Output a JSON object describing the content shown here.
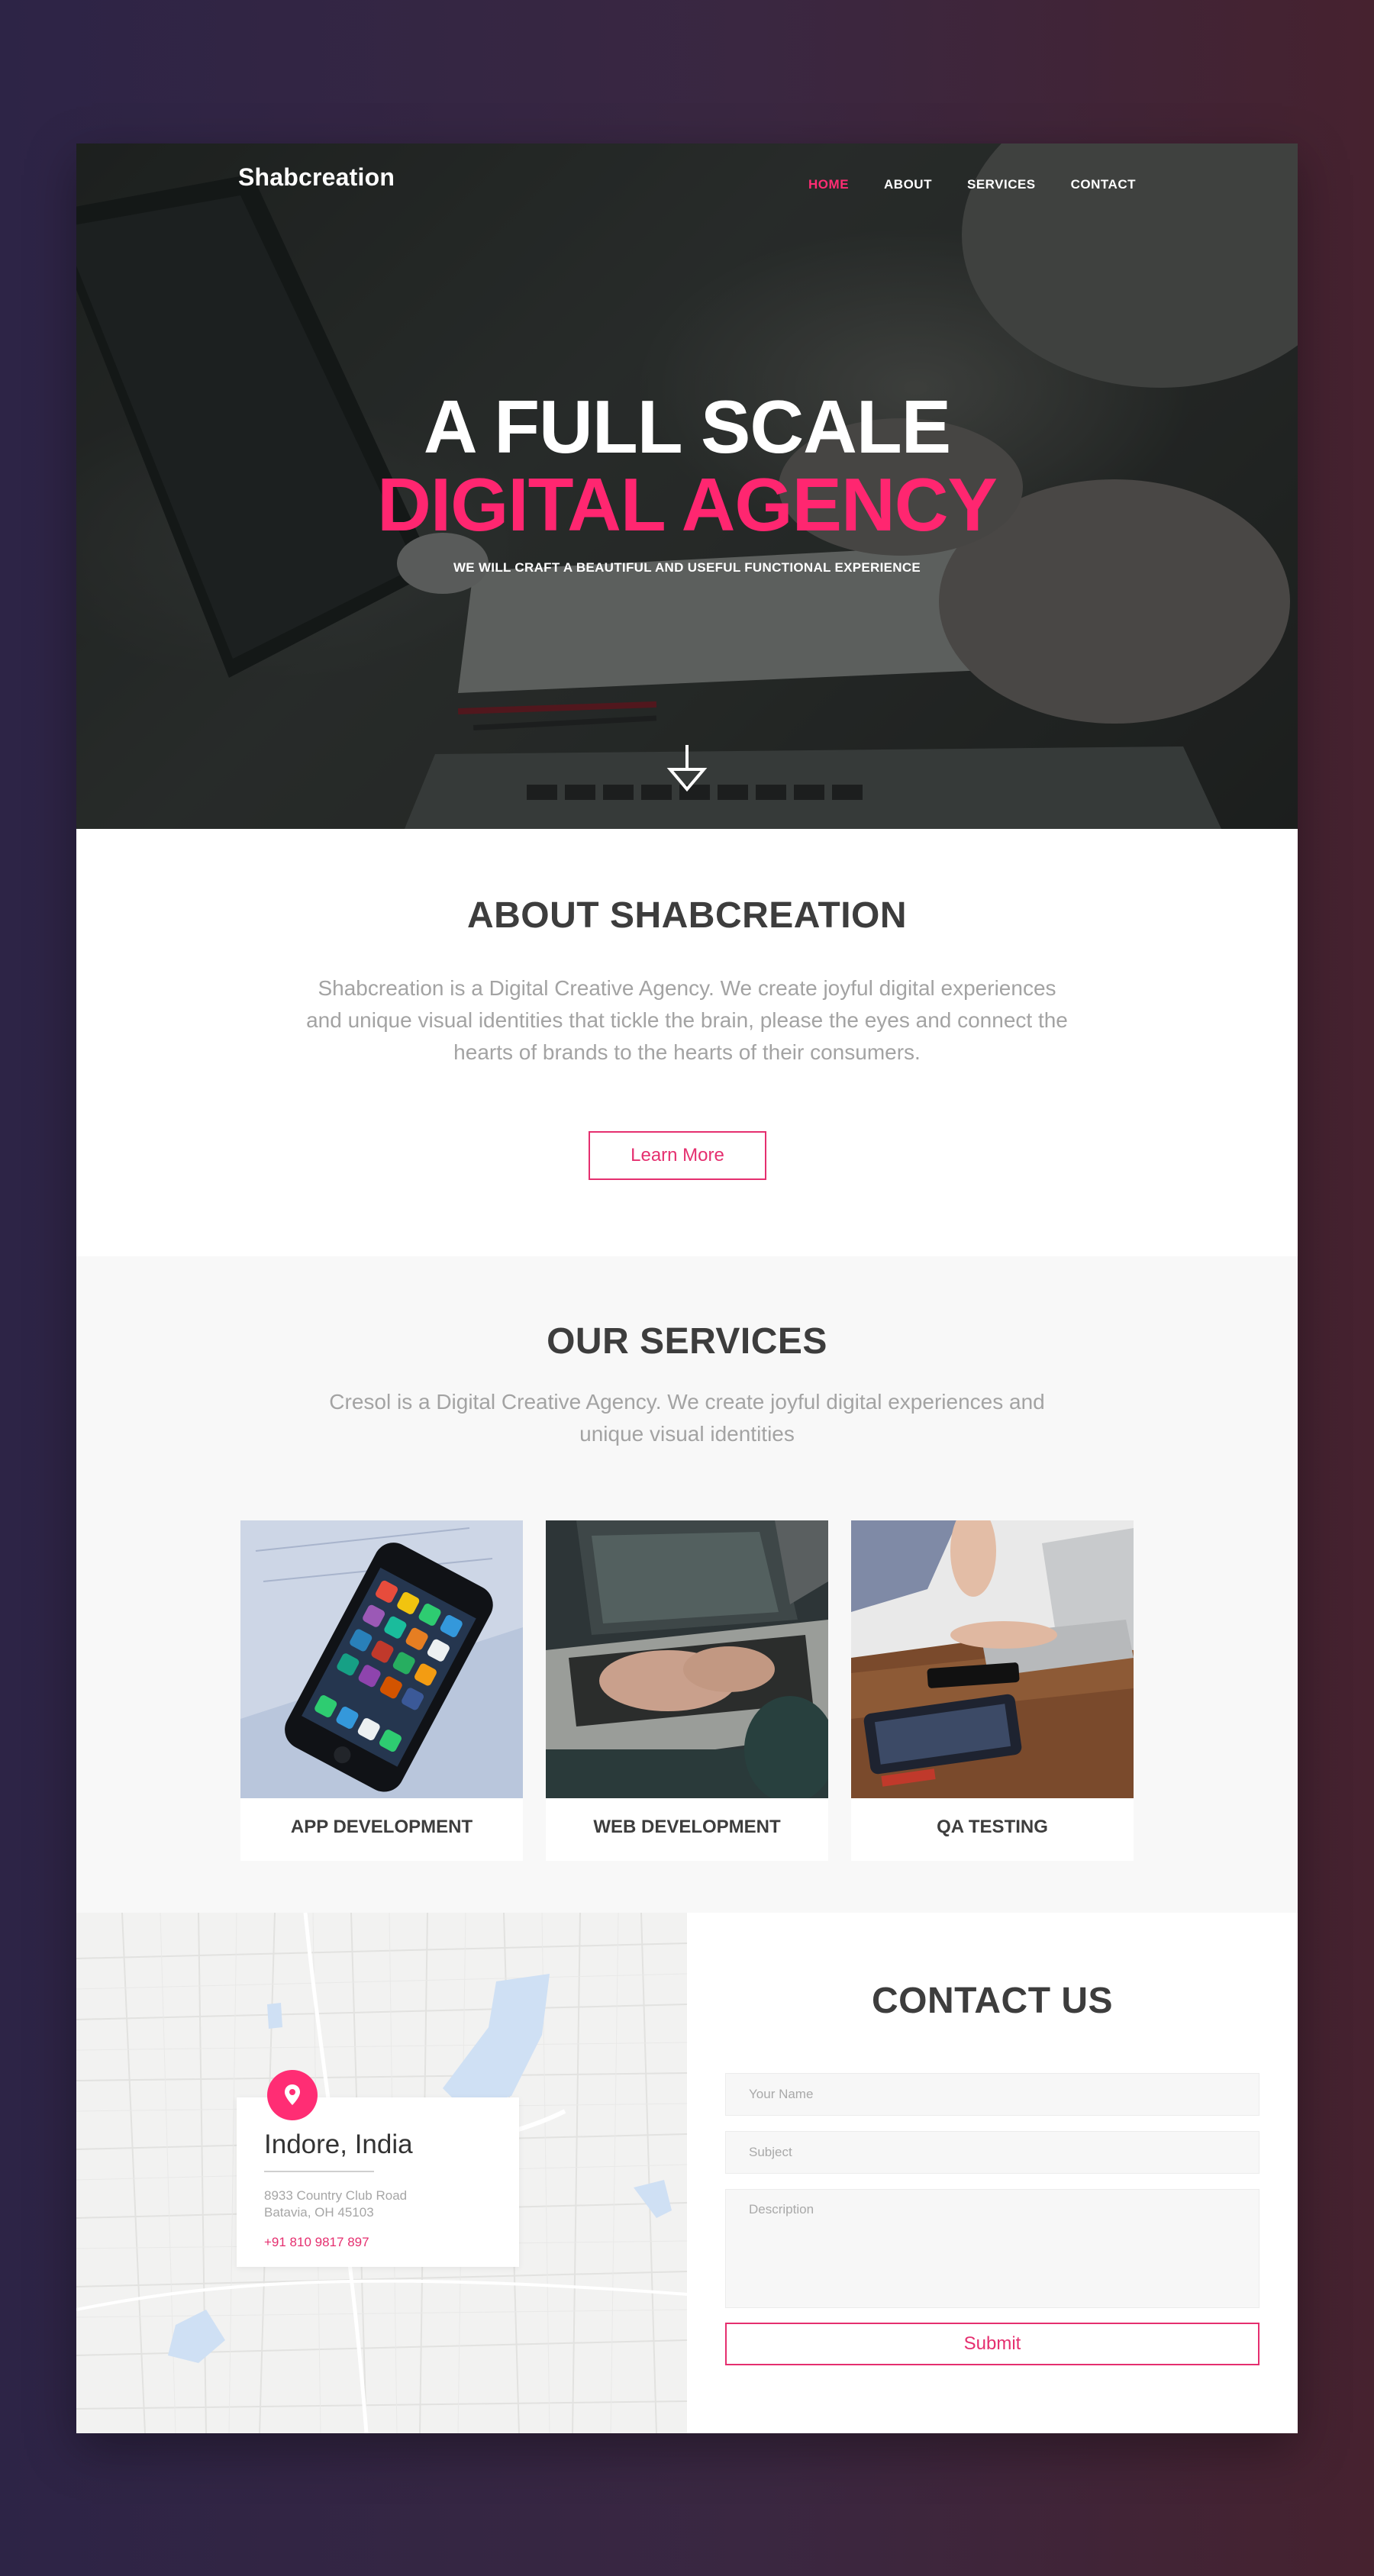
{
  "header": {
    "brand": "Shabcreation",
    "nav": [
      {
        "label": "HOME",
        "active": true
      },
      {
        "label": "ABOUT",
        "active": false
      },
      {
        "label": "SERVICES",
        "active": false
      },
      {
        "label": "CONTACT",
        "active": false
      }
    ]
  },
  "hero": {
    "title_line1": "A FULL SCALE",
    "title_line2": "DIGITAL AGENCY",
    "subtitle": "WE WILL CRAFT A BEAUTIFUL AND USEFUL FUNCTIONAL EXPERIENCE",
    "scroll_icon": "arrow-down-icon"
  },
  "about": {
    "title": "ABOUT SHABCREATION",
    "text": "Shabcreation is a Digital Creative Agency. We create joyful digital experiences and unique visual identities that tickle the brain, please the eyes and connect the hearts of brands to the hearts of their consumers.",
    "button_label": "Learn More"
  },
  "services": {
    "title": "OUR SERVICES",
    "text": "Cresol is a Digital Creative Agency. We create joyful digital experiences and unique visual identities",
    "cards": [
      {
        "label": "APP DEVELOPMENT"
      },
      {
        "label": "WEB DEVELOPMENT"
      },
      {
        "label": "QA TESTING"
      }
    ]
  },
  "contact": {
    "title": "CONTACT US",
    "location": {
      "city": "Indore, India",
      "address_line1": "8933 Country Club Road",
      "address_line2": "Batavia, OH 45103",
      "phone": "+91 810 9817 897",
      "icon": "map-pin-icon"
    },
    "form": {
      "name_placeholder": "Your Name",
      "subject_placeholder": "Subject",
      "description_placeholder": "Description",
      "submit_label": "Submit"
    }
  },
  "colors": {
    "accent": "#ff2670",
    "heading": "#3d3d3d",
    "body_text": "#a3a3a3"
  }
}
